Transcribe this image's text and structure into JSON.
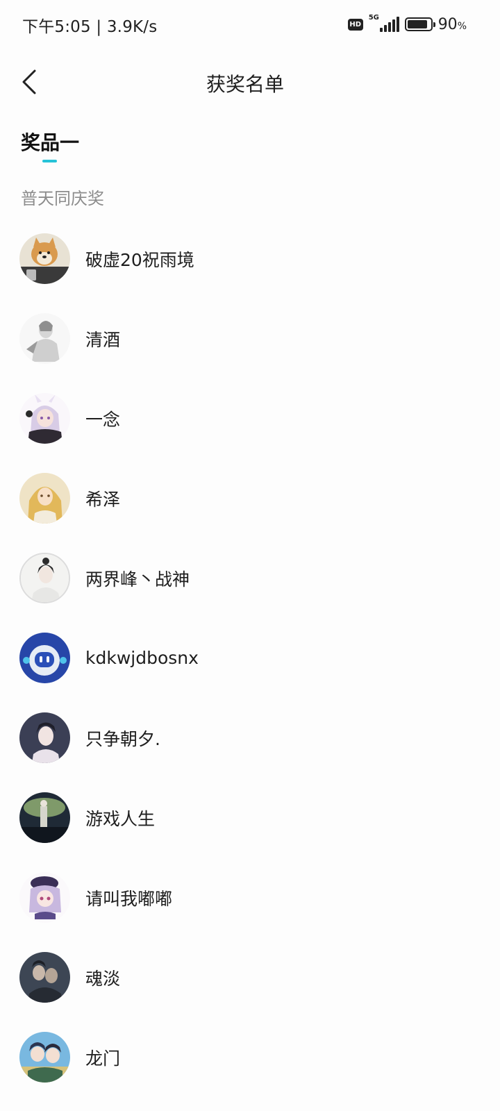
{
  "status_bar": {
    "time": "下午5:05",
    "net_speed": "3.9K/s",
    "hd_badge": "HD",
    "network_type": "5G",
    "battery_level": 90,
    "battery_number": "90",
    "battery_unit": "%"
  },
  "header": {
    "title": "获奖名单",
    "back_icon": "chevron-left-icon"
  },
  "prize_tab": {
    "label": "奖品一",
    "accent_color": "#26c3d8"
  },
  "section": {
    "label": "普天同庆奖"
  },
  "winners": [
    {
      "name": "破虚20祝雨境",
      "avatar": "shiba-dog-avatar"
    },
    {
      "name": "清酒",
      "avatar": "sketch-character-avatar"
    },
    {
      "name": "一念",
      "avatar": "anime-girl-avatar"
    },
    {
      "name": "希泽",
      "avatar": "blonde-character-avatar"
    },
    {
      "name": "两界峰丶战神",
      "avatar": "ink-character-avatar"
    },
    {
      "name": "kdkwjdbosnx",
      "avatar": "robot-avatar"
    },
    {
      "name": "只争朝夕.",
      "avatar": "dark-hair-boy-avatar"
    },
    {
      "name": "游戏人生",
      "avatar": "night-scene-avatar"
    },
    {
      "name": "请叫我嘟嘟",
      "avatar": "purple-hat-girl-avatar"
    },
    {
      "name": "魂淡",
      "avatar": "dark-couple-avatar"
    },
    {
      "name": "龙门",
      "avatar": "two-characters-avatar"
    }
  ]
}
